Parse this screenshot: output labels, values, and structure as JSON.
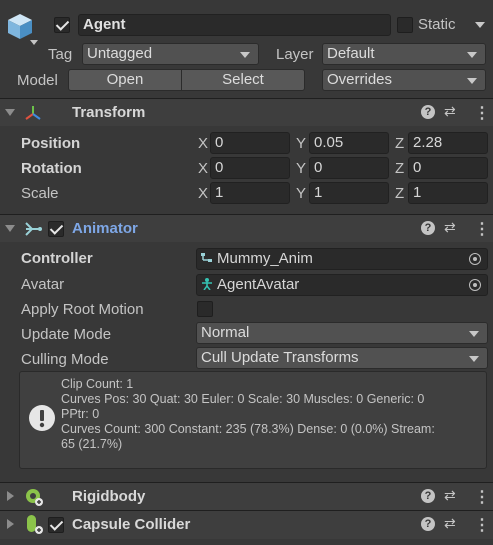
{
  "object": {
    "name": "Agent",
    "active": true,
    "static_label": "Static",
    "static_checked": false,
    "tag_label": "Tag",
    "tag_value": "Untagged",
    "layer_label": "Layer",
    "layer_value": "Default",
    "model_label": "Model",
    "open_button": "Open",
    "select_button": "Select",
    "overrides_dropdown": "Overrides"
  },
  "transform": {
    "title": "Transform",
    "rows": [
      {
        "label": "Position",
        "x": "0",
        "y": "0.05",
        "z": "2.28"
      },
      {
        "label": "Rotation",
        "x": "0",
        "y": "0",
        "z": "0"
      },
      {
        "label": "Scale",
        "x": "1",
        "y": "1",
        "z": "1"
      }
    ],
    "axis_x": "X",
    "axis_y": "Y",
    "axis_z": "Z"
  },
  "animator": {
    "title": "Animator",
    "enabled": true,
    "controller_label": "Controller",
    "controller_value": "Mummy_Anim",
    "avatar_label": "Avatar",
    "avatar_value": "AgentAvatar",
    "apply_root_motion_label": "Apply Root Motion",
    "apply_root_motion_checked": false,
    "update_mode_label": "Update Mode",
    "update_mode_value": "Normal",
    "culling_mode_label": "Culling Mode",
    "culling_mode_value": "Cull Update Transforms",
    "info_lines": [
      "Clip Count: 1",
      "Curves Pos: 30 Quat: 30 Euler: 0 Scale: 30 Muscles: 0 Generic: 0",
      "PPtr: 0",
      "Curves Count: 300 Constant: 235 (78.3%) Dense: 0 (0.0%) Stream:",
      "65 (21.7%)"
    ]
  },
  "rigidbody": {
    "title": "Rigidbody"
  },
  "capsule_collider": {
    "title": "Capsule Collider",
    "enabled": true
  },
  "icons": {
    "header": "prefab-cube-icon",
    "transform": "transform-axes-icon",
    "animator": "animator-icon",
    "rigidbody": "rigidbody-icon",
    "capsule": "capsule-collider-icon",
    "help": "help-icon",
    "preset": "preset-icon",
    "menu": "kebab-menu-icon",
    "warning": "info-icon"
  },
  "colors": {
    "background": "#383838",
    "header": "#3e3e3e",
    "field": "#2a2a2a",
    "animator_title": "#7ea7e6",
    "text": "#c4c4c4"
  }
}
